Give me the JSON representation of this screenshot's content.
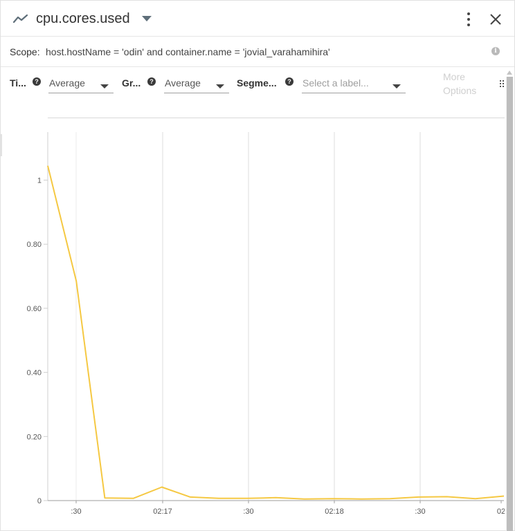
{
  "header": {
    "title": "cpu.cores.used",
    "metric_icon": "line-chart-icon",
    "menu_icon": "more-vert-icon",
    "close_icon": "close-icon"
  },
  "scope": {
    "label": "Scope:",
    "value": "host.hostName = 'odin' and container.name = 'jovial_varahamihira'",
    "info_icon": "info-icon"
  },
  "controls": {
    "time_label": "Ti...",
    "time_value": "Average",
    "group_label": "Gr...",
    "group_value": "Average",
    "segment_label": "Segme...",
    "segment_placeholder": "Select a label...",
    "more_options": "More Options",
    "help_icon": "help-icon",
    "grip_icon": "drag-handle-icon"
  },
  "chart_data": {
    "type": "line",
    "title": "",
    "xlabel": "",
    "ylabel": "",
    "ylim": [
      0,
      1.15
    ],
    "y_ticks": [
      0,
      0.2,
      0.4,
      0.6,
      0.8,
      1
    ],
    "y_tick_labels": [
      "0",
      "0.20",
      "0.40",
      "0.60",
      "0.80",
      "1"
    ],
    "x_tick_labels": [
      ":30",
      "02:17",
      ":30",
      "02:18",
      ":30",
      "02"
    ],
    "grid": true,
    "line_color": "#f5c842",
    "series": [
      {
        "values": [
          1.045,
          0.685,
          0.008,
          0.007,
          0.042,
          0.011,
          0.007,
          0.007,
          0.009,
          0.005,
          0.006,
          0.005,
          0.006,
          0.011,
          0.012,
          0.006,
          0.014
        ]
      }
    ]
  }
}
